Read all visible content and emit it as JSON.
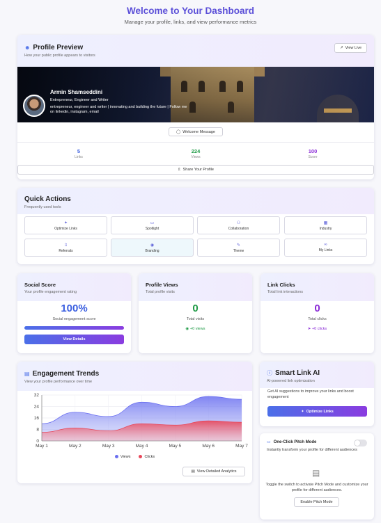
{
  "header": {
    "title": "Welcome to Your Dashboard",
    "subtitle": "Manage your profile, links, and view performance metrics"
  },
  "profile": {
    "title": "Profile Preview",
    "subtitle": "How your public profile appears to visitors",
    "view_live": "View Live",
    "name": "Armin Shamseddini",
    "tagline": "Entrepreneur, Engineer and Writer",
    "bio": "entrepreneur, engineer and writer | innovating and building the future | Follow me on linkedin, instagram, email",
    "welcome_button": "Welcome Message",
    "stats": [
      {
        "value": "5",
        "label": "Links",
        "color": "#3b5fe0"
      },
      {
        "value": "224",
        "label": "Views",
        "color": "#1e9a45"
      },
      {
        "value": "100",
        "label": "Score",
        "color": "#8a2ad6"
      }
    ],
    "share_button": "Share Your Profile"
  },
  "quick_actions": {
    "title": "Quick Actions",
    "subtitle": "Frequently used tools",
    "items": [
      {
        "label": "Optimize Links",
        "icon": "sparkle-icon"
      },
      {
        "label": "Spotlight",
        "icon": "monitor-icon"
      },
      {
        "label": "Collaboration",
        "icon": "users-icon"
      },
      {
        "label": "Industry",
        "icon": "building-icon"
      },
      {
        "label": "Referrals",
        "icon": "share-icon"
      },
      {
        "label": "Branding",
        "icon": "palette-icon"
      },
      {
        "label": "Theme",
        "icon": "brush-icon"
      },
      {
        "label": "My Links",
        "icon": "link-icon"
      }
    ]
  },
  "social_score": {
    "title": "Social Score",
    "subtitle": "Your profile engagement rating",
    "value": "100%",
    "label": "Social engagement score",
    "progress": 1.0,
    "button": "View Details"
  },
  "profile_views": {
    "title": "Profile Views",
    "subtitle": "Total profile visits",
    "value": "0",
    "label": "Total visits",
    "delta": "+0 views"
  },
  "link_clicks": {
    "title": "Link Clicks",
    "subtitle": "Total link interactions",
    "value": "0",
    "label": "Total clicks",
    "delta": "+0 clicks"
  },
  "engagement": {
    "title": "Engagement Trends",
    "subtitle": "View your profile performance over time",
    "button": "View Detailed Analytics"
  },
  "chart_data": {
    "type": "area",
    "categories": [
      "May 1",
      "May 2",
      "May 3",
      "May 4",
      "May 5",
      "May 6",
      "May 7"
    ],
    "series": [
      {
        "name": "Views",
        "values": [
          12,
          20,
          17,
          27,
          24,
          31,
          29
        ],
        "color": "#6a6ff0"
      },
      {
        "name": "Clicks",
        "values": [
          6,
          9,
          7,
          12,
          11,
          14,
          13
        ],
        "color": "#e8475a"
      }
    ],
    "ylim": [
      0,
      32
    ],
    "yticks": [
      0,
      8,
      16,
      24,
      32
    ],
    "grid": true,
    "legend": "bottom"
  },
  "smart_link": {
    "title": "Smart Link AI",
    "subtitle": "AI-powered link optimization",
    "text": "Get AI suggestions to improve your links and boost engagement",
    "button": "Optimize Links"
  },
  "pitch": {
    "title": "One-Click Pitch Mode",
    "description": "Instantly transform your profile for different audiences",
    "hint": "Toggle the switch to activate Pitch Mode and customize your profile for different audiences.",
    "button": "Enable Pitch Mode"
  }
}
